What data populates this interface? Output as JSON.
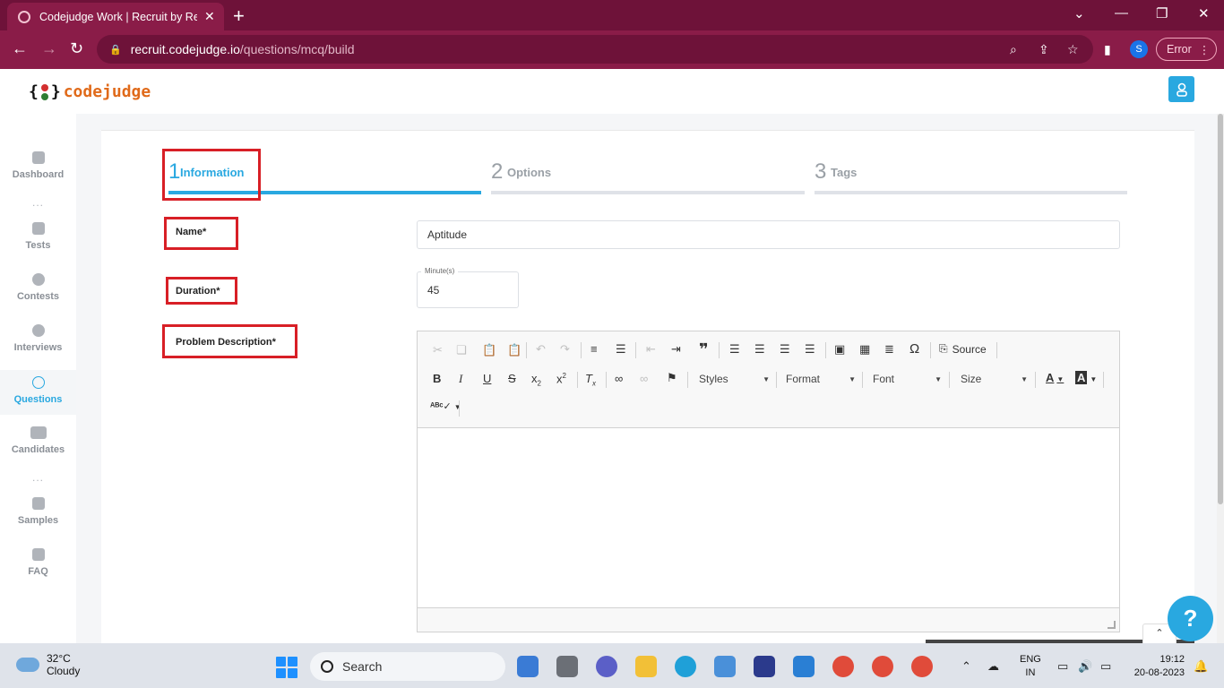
{
  "browser": {
    "tab_title": "Codejudge Work | Recruit by Real",
    "new_tab": "+",
    "url_host": "recruit.codejudge.io",
    "url_path": "/questions/mcq/build",
    "profile_initial": "S",
    "error_label": "Error"
  },
  "app": {
    "logo_text": "codejudge",
    "logo_brace_open": "{",
    "logo_brace_close": "}"
  },
  "sidebar": {
    "items": [
      {
        "label": "Dashboard",
        "icon": "home-icon"
      },
      {
        "label": "Tests",
        "icon": "pencil-icon"
      },
      {
        "label": "Contests",
        "icon": "pie-chart-icon"
      },
      {
        "label": "Interviews",
        "icon": "podcast-icon"
      },
      {
        "label": "Questions",
        "icon": "question-circle-icon"
      },
      {
        "label": "Candidates",
        "icon": "users-icon"
      },
      {
        "label": "Samples",
        "icon": "line-chart-icon"
      },
      {
        "label": "FAQ",
        "icon": "chat-icon"
      }
    ],
    "separator": "..."
  },
  "steps": [
    {
      "num": "1",
      "label": "Information"
    },
    {
      "num": "2",
      "label": "Options"
    },
    {
      "num": "3",
      "label": "Tags"
    }
  ],
  "form": {
    "name_label": "Name*",
    "name_value": "Aptitude",
    "duration_label": "Duration*",
    "duration_caption": "Minute(s)",
    "duration_value": "45",
    "description_label": "Problem Description*"
  },
  "editor": {
    "source_label": "Source",
    "styles_label": "Styles",
    "format_label": "Format",
    "font_label": "Font",
    "size_label": "Size"
  },
  "help_label": "?",
  "taskbar": {
    "temperature": "32°C",
    "weather": "Cloudy",
    "search_label": "Search",
    "lang_line1": "ENG",
    "lang_line2": "IN",
    "time": "19:12",
    "date": "20-08-2023"
  },
  "colors": {
    "accent": "#29a8e0",
    "highlight_box": "#d81f26",
    "browser_frame": "#8a1c48"
  }
}
